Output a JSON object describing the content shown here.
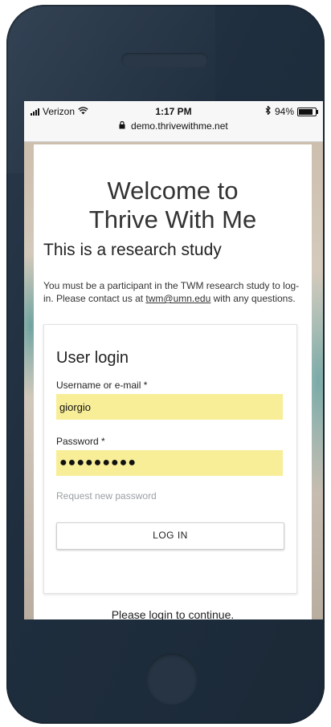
{
  "status_bar": {
    "carrier": "Verizon",
    "time": "1:17 PM",
    "battery": "94%",
    "url": "demo.thrivewithme.net",
    "icons": [
      "signal-icon",
      "wifi-icon",
      "bluetooth-icon",
      "battery-icon",
      "lock-icon"
    ]
  },
  "page": {
    "title_line1": "Welcome to",
    "title_line2": "Thrive With Me",
    "subtitle": "This is a research study",
    "intro_text_before": "You must be a participant in the TWM research study to log-in. Please contact us at ",
    "intro_email": "twm@umn.edu",
    "intro_text_after": " with any questions.",
    "footer": "Please login to continue."
  },
  "login": {
    "heading": "User login",
    "username_label": "Username or e-mail *",
    "username_value": "giorgio",
    "password_label": "Password *",
    "password_value": "●●●●●●●●●",
    "request_password": "Request new password",
    "button": "LOG IN"
  },
  "colors": {
    "field_autofill": "#f8ee98",
    "phone_frame": "#1f2e3e"
  }
}
